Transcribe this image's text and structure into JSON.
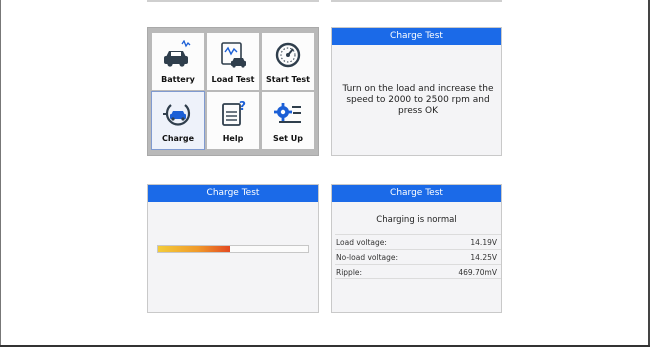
{
  "menu": {
    "items": [
      {
        "label": "Battery",
        "icon": "car-battery-icon"
      },
      {
        "label": "Load Test",
        "icon": "load-test-icon"
      },
      {
        "label": "Start Test",
        "icon": "gauge-icon"
      },
      {
        "label": "Charge",
        "icon": "charge-plug-icon",
        "selected": true
      },
      {
        "label": "Help",
        "icon": "help-document-icon"
      },
      {
        "label": "Set Up",
        "icon": "settings-gear-icon"
      }
    ]
  },
  "prompt_panel": {
    "title": "Charge Test",
    "message": "Turn on the load and increase the speed to 2000 to 2500 rpm and press OK"
  },
  "progress_panel": {
    "title": "Charge Test",
    "progress_fraction": 0.48
  },
  "result_panel": {
    "title": "Charge Test",
    "status": "Charging is normal",
    "rows": [
      {
        "label": "Load voltage:",
        "value": "14.19V"
      },
      {
        "label": "No-load voltage:",
        "value": "14.25V"
      },
      {
        "label": "Ripple:",
        "value": "469.70mV"
      }
    ]
  },
  "colors": {
    "title_bar": "#1b6ae8",
    "icon_dark": "#2f3e4c",
    "icon_blue": "#1b5fd6"
  }
}
